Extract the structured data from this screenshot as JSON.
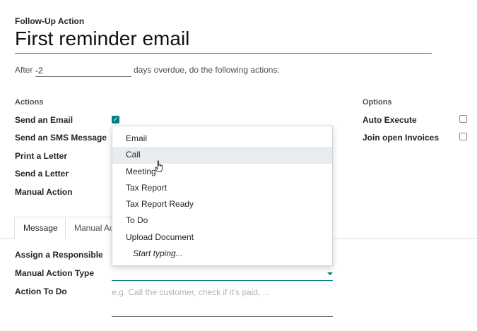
{
  "header": {
    "eyebrow": "Follow-Up Action",
    "title": "First reminder email"
  },
  "delay": {
    "prefix": "After",
    "value": "-2",
    "suffix": "days overdue, do the following actions:"
  },
  "actions": {
    "heading": "Actions",
    "items": [
      {
        "label": "Send an Email",
        "checked": true
      },
      {
        "label": "Send an SMS Message"
      },
      {
        "label": "Print a Letter"
      },
      {
        "label": "Send a Letter"
      },
      {
        "label": "Manual Action"
      }
    ]
  },
  "options": {
    "heading": "Options",
    "items": [
      {
        "label": "Auto Execute",
        "checked": false
      },
      {
        "label": "Join open Invoices",
        "checked": false
      }
    ]
  },
  "tabs": [
    {
      "label": "Message",
      "active": true
    },
    {
      "label": "Manual Ac"
    }
  ],
  "manual": {
    "responsible_label": "Assign a Responsible",
    "type_label": "Manual Action Type",
    "todo_label": "Action To Do",
    "todo_placeholder": "e.g. Call the customer, check if it's paid, ..."
  },
  "dropdown": {
    "options": [
      "Email",
      "Call",
      "Meeting",
      "Tax Report",
      "Tax Report Ready",
      "To Do",
      "Upload Document"
    ],
    "hovered": "Call",
    "hint": "Start typing..."
  },
  "colors": {
    "accent": "#017e84"
  },
  "icons": {
    "cursor": "hand-pointer-icon",
    "caret": "caret-down-icon",
    "check": "check-icon"
  }
}
